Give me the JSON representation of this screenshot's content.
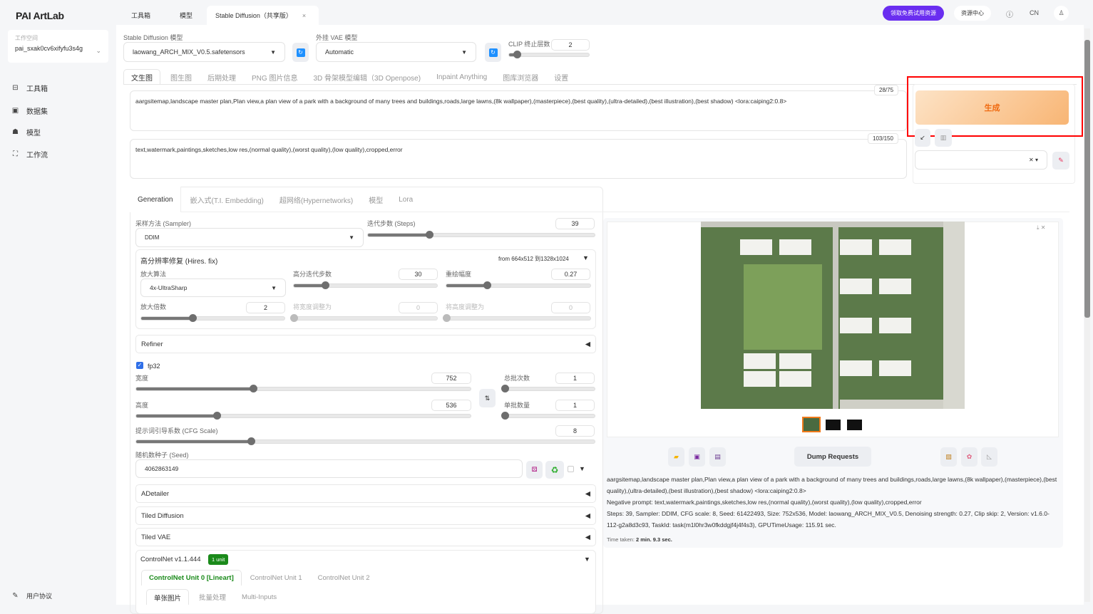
{
  "app": {
    "logo": "PAI ArtLab",
    "workspace_label": "工作空间",
    "workspace": "pai_sxak0cv6xifyfu3s4g"
  },
  "nav": [
    {
      "label": "工具箱",
      "icon": "toolbox-icon"
    },
    {
      "label": "数据集",
      "icon": "dataset-icon"
    },
    {
      "label": "模型",
      "icon": "model-icon"
    },
    {
      "label": "工作流",
      "icon": "workflow-icon"
    }
  ],
  "footer_link": "用户协议",
  "top_tabs": [
    "工具箱",
    "模型",
    "Stable Diffusion（共享版）"
  ],
  "header": {
    "promo": "领取免费试用资源",
    "resource_center": "资源中心",
    "lang": "CN"
  },
  "model": {
    "sd_label": "Stable Diffusion 模型",
    "sd_value": "laowang_ARCH_MIX_V0.5.safetensors",
    "vae_label": "外挂 VAE 模型",
    "vae_value": "Automatic",
    "clip_label": "CLIP 终止层数",
    "clip_value": "2",
    "clip_frac": 0.1
  },
  "main_tabs": [
    "文生图",
    "图生图",
    "后期处理",
    "PNG 图片信息",
    "3D 骨架模型编辑（3D Openpose)",
    "Inpaint Anything",
    "图库浏览器",
    "设置"
  ],
  "prompt": {
    "positive": "aargsitemap,landscape master plan,Plan view,a plan view of a park with a background of many trees and buildings,roads,large lawns,(8k wallpaper),(masterpiece),(best quality),(ultra-detailed),(best illustration),(best shadow) <lora:caiping2:0.8>",
    "positive_count": "28/75",
    "negative": "text,watermark,paintings,sketches,low res,(normal quality),(worst quality),(low quality),cropped,error",
    "negative_count": "103/150"
  },
  "generate_label": "生成",
  "sub_tabs": [
    "Generation",
    "嵌入式(T.I. Embedding)",
    "超网络(Hypernetworks)",
    "模型",
    "Lora"
  ],
  "gen": {
    "sampler_label": "采样方法 (Sampler)",
    "sampler": "DDIM",
    "steps_label": "迭代步数 (Steps)",
    "steps": "39",
    "steps_frac": 0.27,
    "hires_title": "高分辨率修复 (Hires. fix)",
    "hires_info": "from 664x512 到1328x1024",
    "upscaler_label": "放大算法",
    "upscaler": "4x-UltraSharp",
    "hires_steps_label": "高分迭代步数",
    "hires_steps": "30",
    "hires_steps_frac": 0.22,
    "denoise_label": "重绘幅度",
    "denoise": "0.27",
    "denoise_frac": 0.28,
    "scale_label": "放大倍数",
    "scale": "2",
    "scale_frac": 0.36,
    "resize_w_label": "将宽度调整为",
    "resize_w": "0",
    "resize_h_label": "将高度调整为",
    "resize_h": "0",
    "refiner": "Refiner",
    "fp32": "fp32",
    "width_label": "宽度",
    "width": "752",
    "width_frac": 0.35,
    "height_label": "高度",
    "height": "536",
    "height_frac": 0.24,
    "batch_count_label": "总批次数",
    "batch_count": "1",
    "batch_size_label": "单批数量",
    "batch_size": "1",
    "cfg_label": "提示词引导系数 (CFG Scale)",
    "cfg": "8",
    "cfg_frac": 0.25,
    "seed_label": "随机数种子 (Seed)",
    "seed": "4062863149",
    "adetailer": "ADetailer",
    "tiled_diffusion": "Tiled Diffusion",
    "tiled_vae": "Tiled VAE",
    "controlnet": "ControlNet v1.1.444",
    "controlnet_badge": "1 unit",
    "cn_tabs": [
      "ControlNet Unit 0 [Lineart]",
      "ControlNet Unit 1",
      "ControlNet Unit 2"
    ],
    "cn_sub_tabs": [
      "单张图片",
      "批量处理",
      "Multi-Inputs"
    ]
  },
  "output": {
    "dump": "Dump Requests",
    "info_prompt": "aargsitemap,landscape master plan,Plan view,a plan view of a park with a background of many trees and buildings,roads,large lawns,(8k wallpaper),(masterpiece),(best quality),(ultra-detailed),(best illustration),(best shadow) <lora:caiping2:0.8>",
    "info_negative": "Negative prompt: text,watermark,paintings,sketches,low res,(normal quality),(worst quality),(low quality),cropped,error",
    "info_params": "Steps: 39, Sampler: DDIM, CFG scale: 8, Seed: 61422493, Size: 752x536, Model: laowang_ARCH_MIX_V0.5, Denoising strength: 0.27, Clip skip: 2, Version: v1.6.0-112-g2a8d3c93, TaskId: task(m1l0hr3w0fkddgjf4j4f4s3), GPUTimeUsage: 115.91 sec.",
    "time_label": "Time taken:",
    "time_value": "2 min. 9.3 sec."
  },
  "colors": {
    "accent": "#6a2ef0",
    "generate": "#f7b47a",
    "highlight": "#ff0000",
    "badge": "#1a8a1a"
  }
}
